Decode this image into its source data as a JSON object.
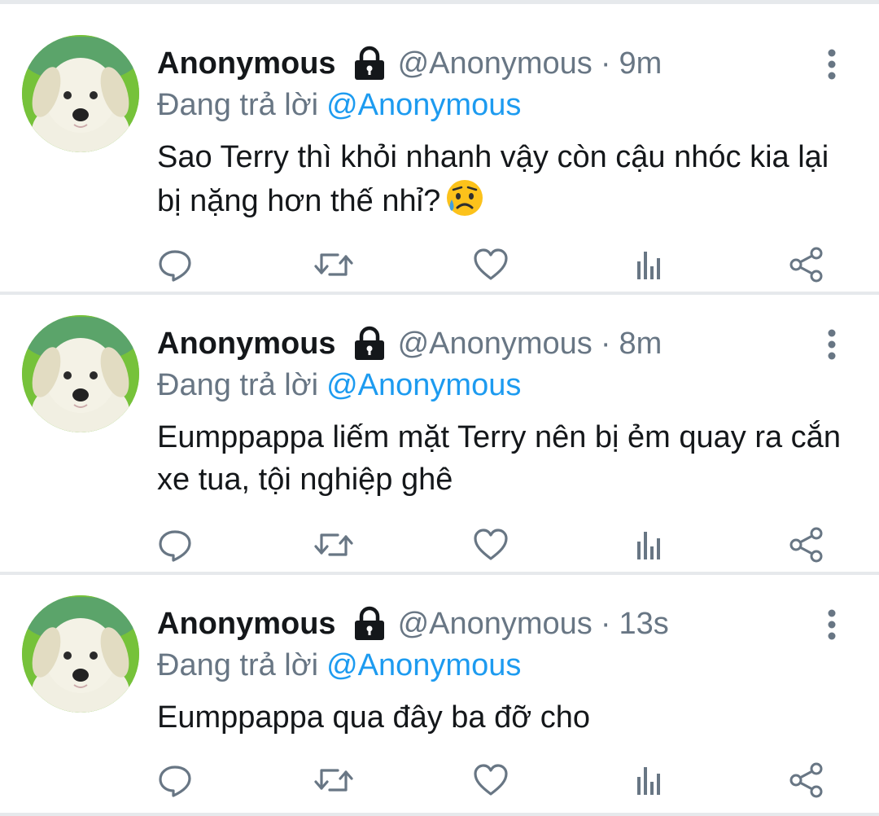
{
  "colors": {
    "name": "#14171a",
    "muted": "#687684",
    "link": "#1d9bf0",
    "divider": "#e6e9ec",
    "icon": "#687684"
  },
  "tweets": [
    {
      "display_name": "Anonymous",
      "lock_icon": "lock-icon",
      "handle": "@Anonymous",
      "separator": "·",
      "time": "9m",
      "reply_prefix": "Đang trả lời",
      "reply_target": "@Anonymous",
      "text": "Sao Terry thì khỏi nhanh vậy còn cậu nhóc kia lại bị nặng hơn thế nhỉ?",
      "emoji": "sad-but-relieved-face-emoji"
    },
    {
      "display_name": "Anonymous",
      "lock_icon": "lock-icon",
      "handle": "@Anonymous",
      "separator": "·",
      "time": "8m",
      "reply_prefix": "Đang trả lời",
      "reply_target": "@Anonymous",
      "text": "Eumppappa liếm mặt Terry nên bị ẻm quay ra cắn xe tua, tội nghiệp ghê"
    },
    {
      "display_name": "Anonymous",
      "lock_icon": "lock-icon",
      "handle": "@Anonymous",
      "separator": "·",
      "time": "13s",
      "reply_prefix": "Đang trả lời",
      "reply_target": "@Anonymous",
      "text": "Eumppappa qua đây ba đỡ cho"
    }
  ],
  "action_icons": [
    "reply-icon",
    "retweet-icon",
    "like-icon",
    "analytics-icon",
    "share-icon"
  ]
}
